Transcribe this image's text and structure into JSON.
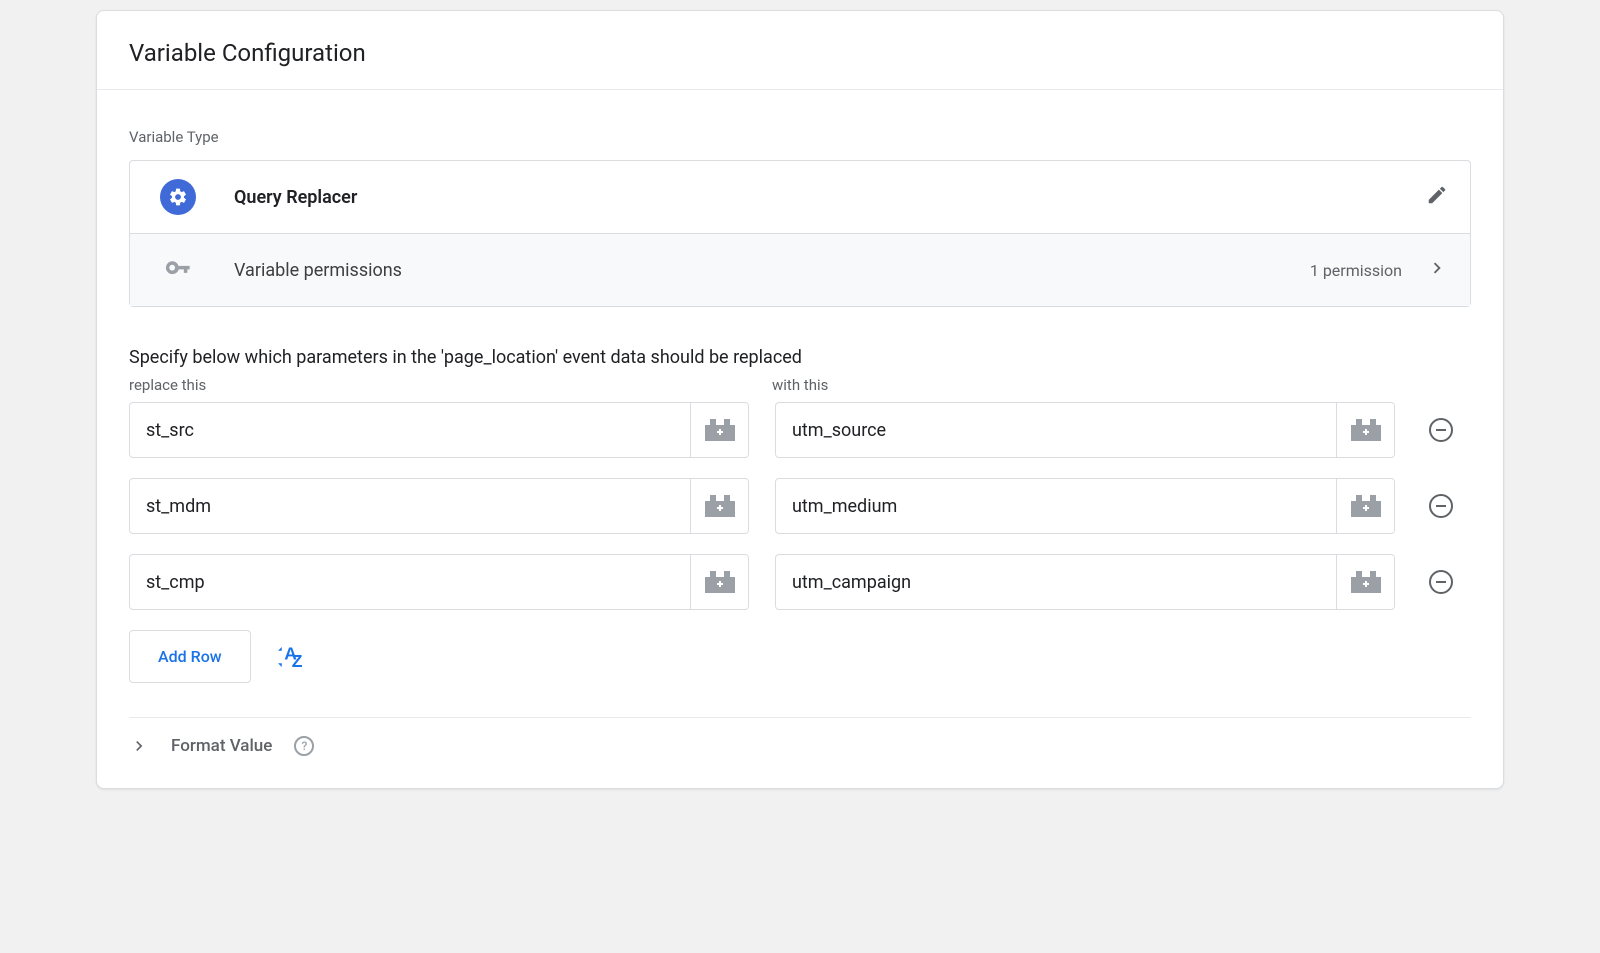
{
  "header": {
    "title": "Variable Configuration"
  },
  "variableTypeLabel": "Variable Type",
  "type": {
    "name": "Query Replacer",
    "permissionsLabel": "Variable permissions",
    "permissionsCount": "1 permission"
  },
  "instruction": "Specify below which parameters in the 'page_location' event data should be replaced",
  "columns": {
    "left": "replace this",
    "right": "with this"
  },
  "rows": [
    {
      "replace": "st_src",
      "with": "utm_source"
    },
    {
      "replace": "st_mdm",
      "with": "utm_medium"
    },
    {
      "replace": "st_cmp",
      "with": "utm_campaign"
    }
  ],
  "buttons": {
    "addRow": "Add Row"
  },
  "formatValue": "Format Value"
}
